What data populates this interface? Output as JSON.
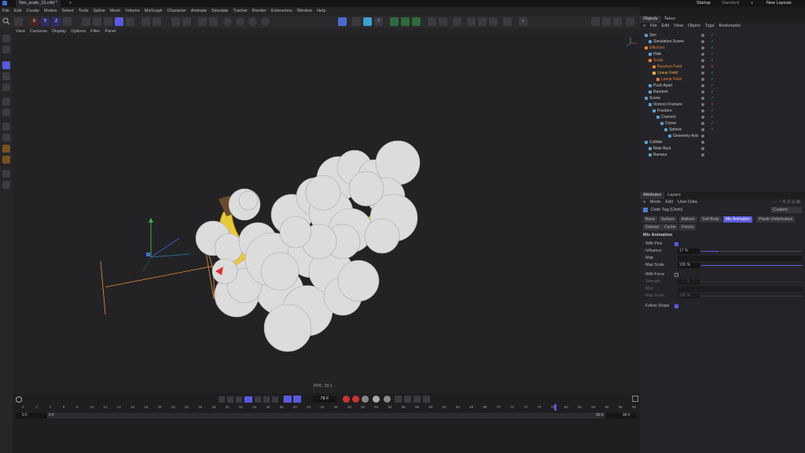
{
  "titlebar": {
    "tab_title": "Sim_scale_15.c4d *",
    "layouts": [
      "Startup",
      "Standard"
    ],
    "new_layouts": "New Layouts"
  },
  "menubar": {
    "items": [
      "File",
      "Edit",
      "Create",
      "Modes",
      "Select",
      "Tools",
      "Spline",
      "Mesh",
      "Volume",
      "MoGraph",
      "Character",
      "Animate",
      "Simulate",
      "Tracker",
      "Render",
      "Extensions",
      "Window",
      "Help"
    ]
  },
  "toolbar": {
    "axis_labels": [
      "X",
      "Y",
      "Z"
    ]
  },
  "viewport": {
    "menu": [
      "View",
      "Cameras",
      "Display",
      "Options",
      "Filter",
      "Panel"
    ],
    "fps": "FPS : 23.1"
  },
  "timeline": {
    "current_frame": "78 F",
    "start_frame": "0 F",
    "start_frame2": "0 F",
    "end_frame": "90 F",
    "end_frame2": "90 F",
    "ruler": [
      "0",
      "2",
      "4",
      "6",
      "8",
      "10",
      "12",
      "14",
      "16",
      "18",
      "20",
      "22",
      "24",
      "26",
      "28",
      "30",
      "32",
      "34",
      "36",
      "38",
      "40",
      "42",
      "44",
      "46",
      "48",
      "50",
      "52",
      "54",
      "56",
      "58",
      "60",
      "62",
      "64",
      "66",
      "68",
      "70",
      "72",
      "74",
      "76",
      "78",
      "80",
      "82",
      "84",
      "86",
      "88",
      "90"
    ]
  },
  "objects_panel": {
    "tabs": [
      "Objects",
      "Takes"
    ],
    "menu": [
      "File",
      "Edit",
      "View",
      "Object",
      "Tags",
      "Bookmarks"
    ],
    "rows": [
      {
        "name": "Sim",
        "indent": 0,
        "color": "#c8c8c8",
        "mark": "check"
      },
      {
        "name": "Simulation Scene",
        "indent": 1,
        "color": "#c8c8c8",
        "mark": "check"
      },
      {
        "name": "Effectors",
        "indent": 0,
        "color": "#e0813a",
        "mark": "check"
      },
      {
        "name": "Hide",
        "indent": 1,
        "color": "#c8c8c8",
        "mark": "check"
      },
      {
        "name": "Scale",
        "indent": 1,
        "color": "#e0813a",
        "mark": "check"
      },
      {
        "name": "Random Field",
        "indent": 2,
        "color": "#e0813a",
        "mark": "cross"
      },
      {
        "name": "Linear Field",
        "indent": 2,
        "color": "#f0b040",
        "mark": "check"
      },
      {
        "name": "Linear Field",
        "indent": 3,
        "color": "#e0813a",
        "mark": "check"
      },
      {
        "name": "Push Apart",
        "indent": 1,
        "color": "#c8c8c8",
        "mark": "check"
      },
      {
        "name": "Random",
        "indent": 1,
        "color": "#c8c8c8",
        "mark": "check"
      },
      {
        "name": "Scene",
        "indent": 0,
        "color": "#c8c8c8",
        "mark": "check"
      },
      {
        "name": "Voronoi Fracture",
        "indent": 1,
        "color": "#c8c8c8",
        "mark": "cross"
      },
      {
        "name": "Fracture",
        "indent": 2,
        "color": "#c8c8c8",
        "mark": "check"
      },
      {
        "name": "Connect",
        "indent": 3,
        "color": "#c8c8c8",
        "mark": "check"
      },
      {
        "name": "Cloner",
        "indent": 4,
        "color": "#c8c8c8",
        "mark": "check"
      },
      {
        "name": "Sphere",
        "indent": 5,
        "color": "#c8c8c8",
        "mark": "check"
      },
      {
        "name": "Geometry Axis",
        "indent": 6,
        "color": "#c8c8c8",
        "mark": "none"
      },
      {
        "name": "Collider",
        "indent": 0,
        "color": "#c8c8c8",
        "mark": "none"
      },
      {
        "name": "Male Bust",
        "indent": 1,
        "color": "#c8c8c8",
        "mark": "none"
      },
      {
        "name": "Banana",
        "indent": 1,
        "color": "#c8c8c8",
        "mark": "none"
      }
    ]
  },
  "attributes_panel": {
    "tabs": [
      "Attributes",
      "Layers"
    ],
    "menu": [
      "Mode",
      "Edit",
      "User Data"
    ],
    "tag_title": "Cloth Tag [Cloth]",
    "preset": "Custom",
    "sub_tabs_row1": [
      "Basic",
      "Surface",
      "Balloon",
      "Soft Body",
      "Mix Animation",
      "Plastic Deformation"
    ],
    "sub_tabs_row2": [
      "Dresser",
      "Cache",
      "Forces"
    ],
    "active_tab": "Mix Animation",
    "section": "Mix Animation",
    "fields": {
      "with_pins": "With Pins",
      "influence": "Influence",
      "influence_value": "17 %",
      "map": "Map",
      "map_scale": "Map Scale",
      "map_scale_value": "100 %",
      "with_force": "With Force",
      "strength": "Strength",
      "strength_value": "1",
      "map2": "Map",
      "map_scale2": "Map Scale",
      "map_scale2_value": "100 %",
      "follow_shape": "Follow Shape"
    },
    "influence_level": 0.17,
    "map_scale_level": 1.0
  },
  "colors": {
    "accent": "#5a5ae0",
    "orange": "#e0813a",
    "green_check": "#4caf50",
    "red_x": "#d33"
  }
}
